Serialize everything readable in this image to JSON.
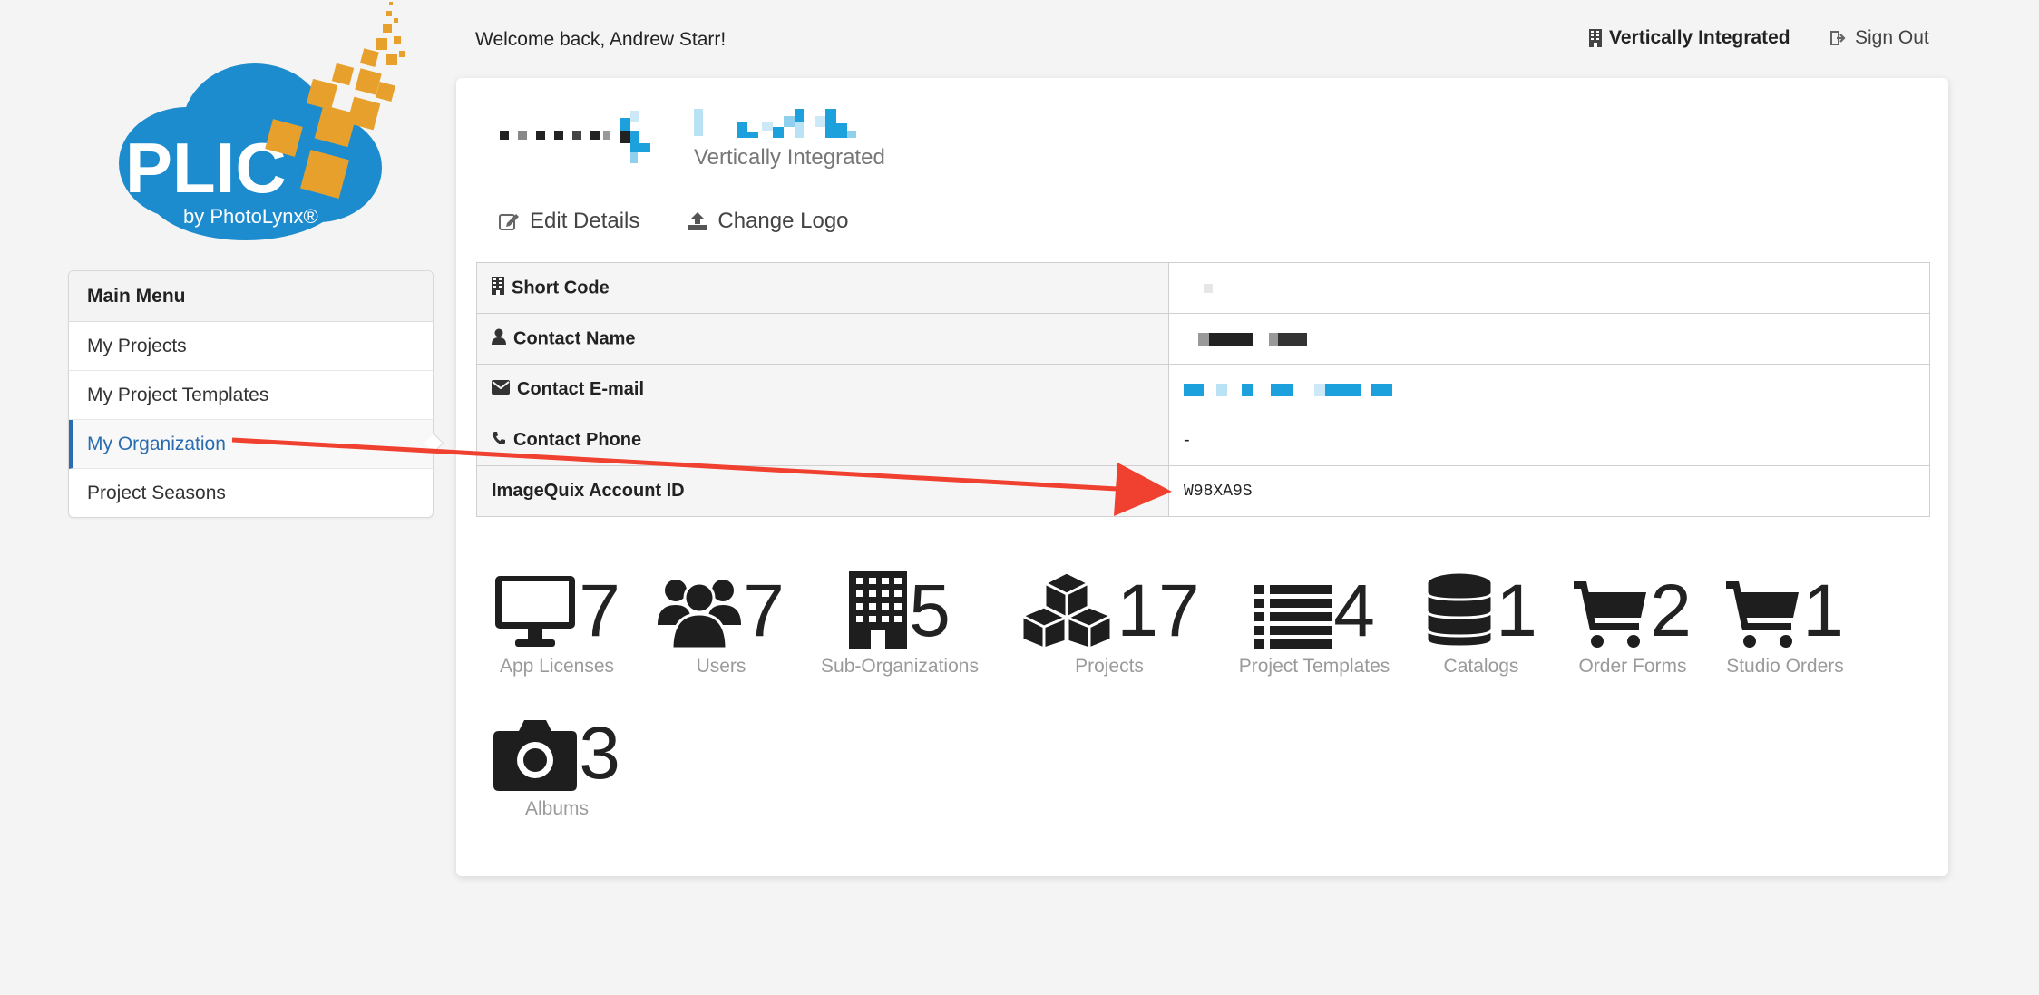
{
  "header": {
    "welcome": "Welcome back, Andrew Starr!",
    "org_name": "Vertically Integrated",
    "sign_out": "Sign Out"
  },
  "logo": {
    "brand": "PLIC",
    "byline": "by PhotoLynx®",
    "colors": {
      "cloud": "#1c8ccf",
      "squares": "#e8a02c"
    }
  },
  "sidebar": {
    "title": "Main Menu",
    "items": [
      {
        "label": "My Projects"
      },
      {
        "label": "My Project Templates"
      },
      {
        "label": "My Organization",
        "active": true
      },
      {
        "label": "Project Seasons"
      }
    ]
  },
  "org": {
    "subtitle": "Vertically Integrated",
    "actions": {
      "edit": "Edit Details",
      "change_logo": "Change Logo"
    }
  },
  "details": {
    "short_code_label": "Short Code",
    "contact_name_label": "Contact Name",
    "contact_email_label": "Contact E-mail",
    "contact_phone_label": "Contact Phone",
    "contact_phone_value": "-",
    "account_id_label": "ImageQuix Account ID",
    "account_id_value": "W98XA9S"
  },
  "stats": [
    {
      "icon": "monitor-icon",
      "value": "7",
      "label": "App Licenses"
    },
    {
      "icon": "users-icon",
      "value": "7",
      "label": "Users"
    },
    {
      "icon": "building-icon",
      "value": "5",
      "label": "Sub-Organizations"
    },
    {
      "icon": "cubes-icon",
      "value": "17",
      "label": "Projects"
    },
    {
      "icon": "list-icon",
      "value": "4",
      "label": "Project Templates"
    },
    {
      "icon": "database-icon",
      "value": "1",
      "label": "Catalogs"
    },
    {
      "icon": "cart-icon",
      "value": "2",
      "label": "Order Forms"
    },
    {
      "icon": "cart-icon",
      "value": "1",
      "label": "Studio Orders"
    },
    {
      "icon": "camera-icon",
      "value": "3",
      "label": "Albums"
    }
  ],
  "annotation": {
    "arrow_color": "#f0402f"
  },
  "theme": {
    "link": "#2a6cb0",
    "muted": "#9a9a9a",
    "redact_blue": "#1da1dc"
  }
}
